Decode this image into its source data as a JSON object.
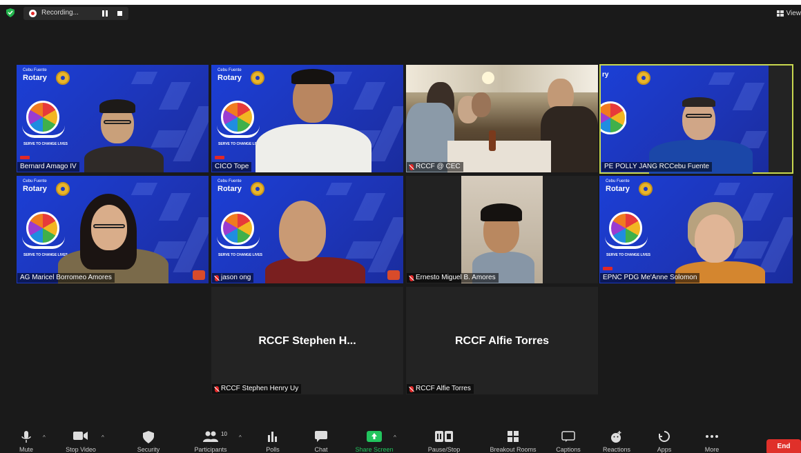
{
  "app": {
    "recording_label": "Recording...",
    "view_label": "View"
  },
  "tiles": [
    {
      "name": "Bernard Amago IV",
      "type": "video-bg"
    },
    {
      "name": "CICO Tope",
      "type": "video-bg"
    },
    {
      "name": "RCCF @ CEC",
      "type": "video-room"
    },
    {
      "name": "PE POLLY JANG RCCebu Fuente",
      "type": "video-bg",
      "active_speaker": true
    },
    {
      "name": "AG Maricel Borromeo Amores",
      "type": "video-bg"
    },
    {
      "name": "jason ong",
      "type": "video-bg"
    },
    {
      "name": "Ernesto Miguel B. Amores",
      "type": "video-plain"
    },
    {
      "name": "EPNC PDG Me'Anne Solomon",
      "type": "video-bg"
    },
    {
      "name": "RCCF Stephen Henry Uy",
      "display": "RCCF Stephen H...",
      "type": "no-video"
    },
    {
      "name": "RCCF Alfie Torres",
      "display": "RCCF Alfie Torres",
      "type": "no-video"
    }
  ],
  "virtual_background": {
    "club_small": "Cebu Fuente",
    "club_big": "Rotary",
    "slogan": "SERVE TO CHANGE LIVES"
  },
  "toolbar": {
    "mute": "Mute",
    "stop_video": "Stop Video",
    "security": "Security",
    "participants": "Participants",
    "participants_count": "10",
    "polls": "Polls",
    "chat": "Chat",
    "share_screen": "Share Screen",
    "recording": "Pause/Stop Recording",
    "breakout": "Breakout Rooms",
    "captions": "Captions",
    "reactions": "Reactions",
    "apps": "Apps",
    "more": "More",
    "end": "End"
  },
  "colors": {
    "meeting_bg": "#1a1a1a",
    "tile_blue": "#1d35b8",
    "active_speaker_border": "#c9d94f",
    "share_green": "#22c55e",
    "end_red": "#e0302a"
  }
}
